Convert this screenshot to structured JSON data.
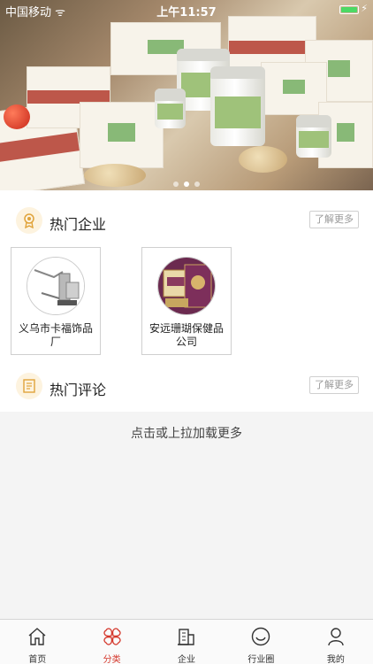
{
  "status_bar": {
    "carrier": "中国移动 ᯤ",
    "time": "上午11:57",
    "battery_color": "#4cd964"
  },
  "banner": {
    "dots": 3,
    "active_dot": 1
  },
  "hot_companies": {
    "title": "热门企业",
    "more_label": "了解更多",
    "items": [
      {
        "name": "义乌市卡福饰品厂"
      },
      {
        "name": "安远珊瑚保健品公司"
      }
    ]
  },
  "hot_reviews": {
    "title": "热门评论",
    "more_label": "了解更多"
  },
  "load_more": "点击或上拉加载更多",
  "tabs": [
    {
      "label": "首页",
      "icon": "home-icon"
    },
    {
      "label": "分类",
      "icon": "category-icon",
      "active": true
    },
    {
      "label": "企业",
      "icon": "building-icon"
    },
    {
      "label": "行业圈",
      "icon": "circle-icon"
    },
    {
      "label": "我的",
      "icon": "user-icon"
    }
  ],
  "colors": {
    "accent": "#d4372b",
    "icon_bg": "#fdf3df",
    "icon_fg": "#e0a33a"
  }
}
